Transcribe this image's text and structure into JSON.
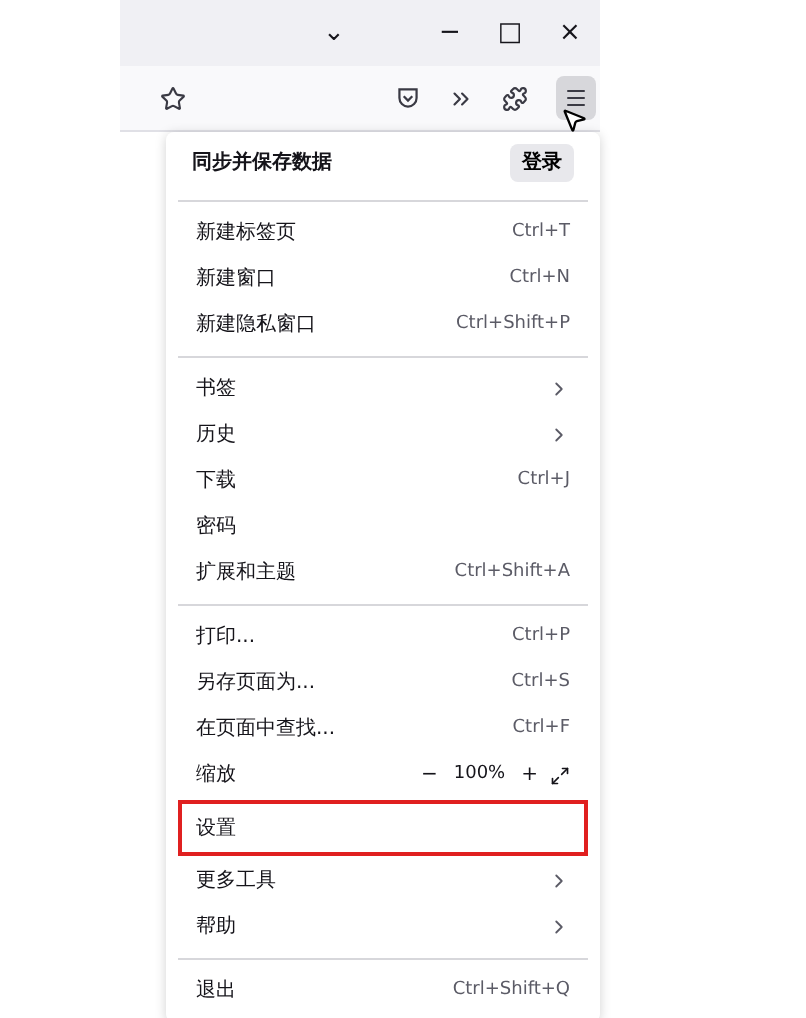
{
  "window_controls": {
    "list_tabs": "⌄",
    "minimize": "−",
    "maximize": "□",
    "close": "×"
  },
  "toolbar": {
    "menu_button": {
      "selected": true
    }
  },
  "menu": {
    "sync": {
      "title": "同步并保存数据",
      "button": "登录"
    },
    "sections": [
      [
        {
          "kind": "item",
          "label": "新建标签页",
          "shortcut": "Ctrl+T",
          "highlighted": false
        },
        {
          "kind": "item",
          "label": "新建窗口",
          "shortcut": "Ctrl+N",
          "highlighted": false
        },
        {
          "kind": "item",
          "label": "新建隐私窗口",
          "shortcut": "Ctrl+Shift+P",
          "highlighted": false
        }
      ],
      [
        {
          "kind": "submenu",
          "label": "书签",
          "highlighted": false
        },
        {
          "kind": "submenu",
          "label": "历史",
          "highlighted": false
        },
        {
          "kind": "item",
          "label": "下载",
          "shortcut": "Ctrl+J",
          "highlighted": false
        },
        {
          "kind": "item",
          "label": "密码",
          "highlighted": false
        },
        {
          "kind": "item",
          "label": "扩展和主题",
          "shortcut": "Ctrl+Shift+A",
          "highlighted": false
        }
      ],
      [
        {
          "kind": "item",
          "label": "打印...",
          "shortcut": "Ctrl+P",
          "highlighted": false
        },
        {
          "kind": "item",
          "label": "另存页面为...",
          "shortcut": "Ctrl+S",
          "highlighted": false
        },
        {
          "kind": "item",
          "label": "在页面中查找...",
          "shortcut": "Ctrl+F",
          "highlighted": false
        },
        {
          "kind": "zoom",
          "label": "缩放",
          "zoom_out": "−",
          "value": "100%",
          "zoom_in": "+",
          "highlighted": false
        },
        {
          "kind": "item",
          "label": "设置",
          "highlighted": true
        },
        {
          "kind": "submenu",
          "label": "更多工具",
          "highlighted": false
        },
        {
          "kind": "submenu",
          "label": "帮助",
          "highlighted": false
        }
      ],
      [
        {
          "kind": "item",
          "label": "退出",
          "shortcut": "Ctrl+Shift+Q",
          "highlighted": false
        }
      ]
    ]
  }
}
